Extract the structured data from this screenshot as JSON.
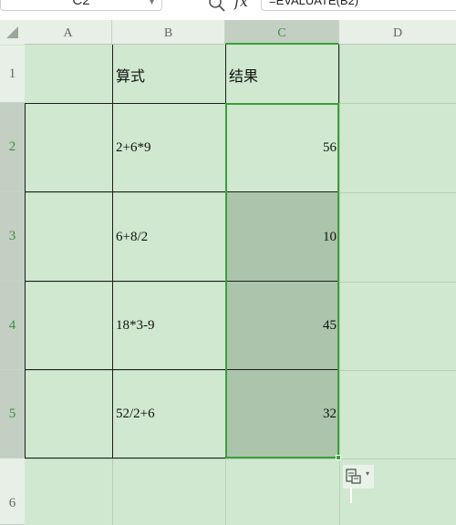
{
  "formula_bar": {
    "name_box": "C2",
    "fx_label": "fx",
    "formula": "=EVALUATE(B2)"
  },
  "columns": [
    "A",
    "B",
    "C",
    "D"
  ],
  "rows": [
    "1",
    "2",
    "3",
    "4",
    "5",
    "6"
  ],
  "cells": {
    "B1": "算式",
    "C1": "结果",
    "B2": "2+6*9",
    "C2": "56",
    "B3": "6+8/2",
    "C3": "10",
    "B4": "18*3-9",
    "C4": "45",
    "B5": "52/2+6",
    "C5": "32"
  },
  "selection": {
    "active_cell": "C2",
    "range": "C2:C5"
  },
  "colors": {
    "sheet_bg": "#cfe8cf",
    "selection": "#3aa03a",
    "selected_shade": "#abc4ab"
  },
  "icons": {
    "search": "search-icon",
    "paste_options": "paste-options-icon"
  }
}
